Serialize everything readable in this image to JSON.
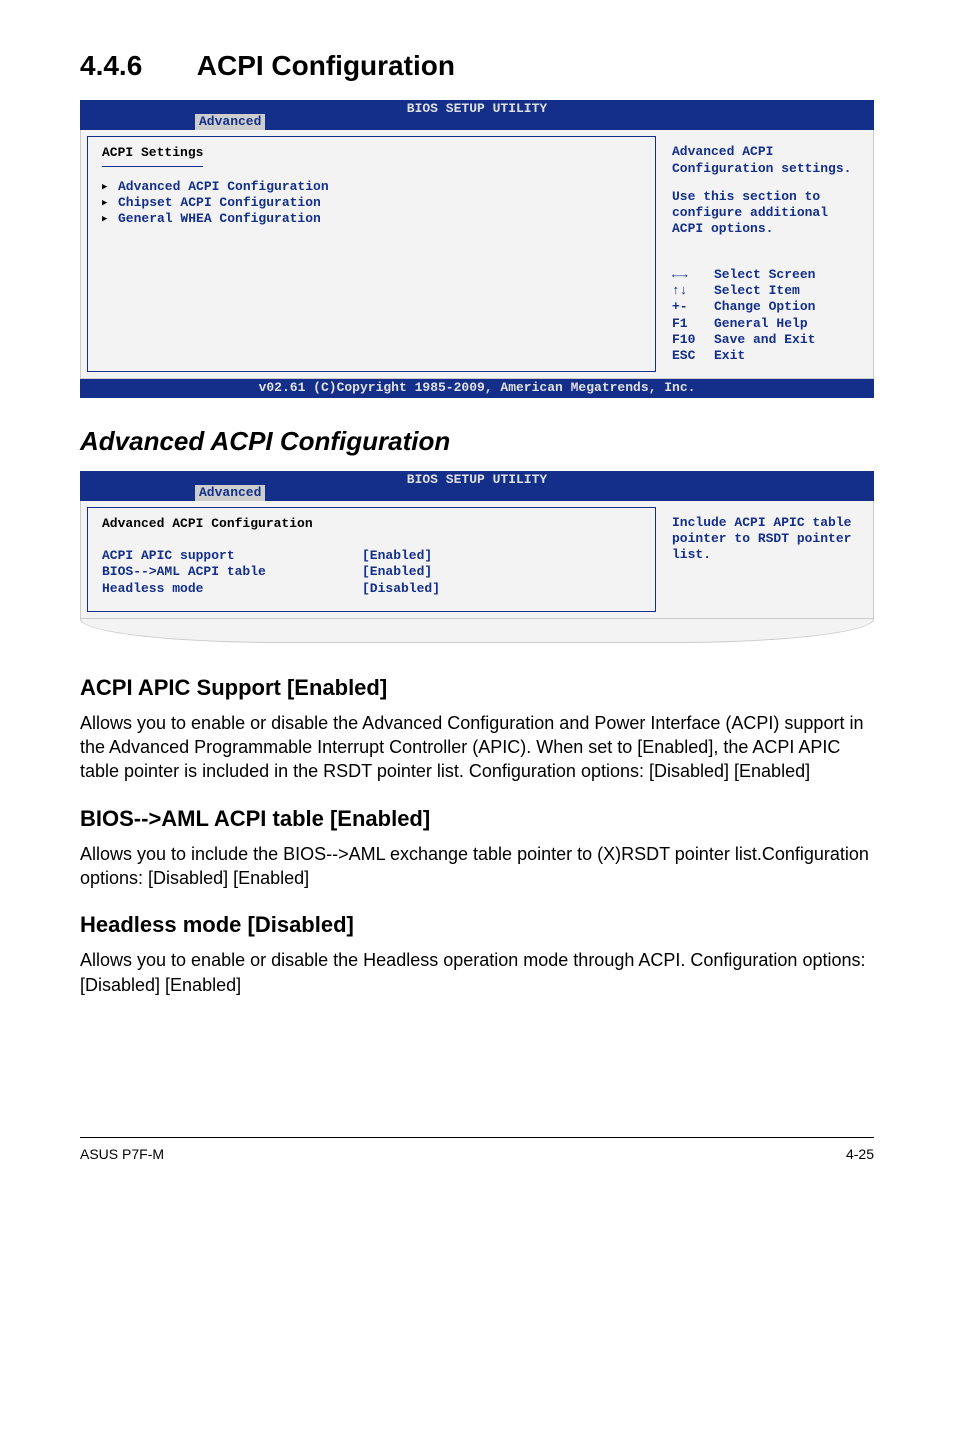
{
  "section": {
    "num": "4.4.6",
    "title": "ACPI Configuration"
  },
  "bios1": {
    "utility_title": "BIOS SETUP UTILITY",
    "tab": "Advanced",
    "heading": "ACPI Settings",
    "items": {
      "a": "Advanced ACPI Configuration",
      "b": "Chipset ACPI Configuration",
      "c": "General WHEA Configuration"
    },
    "help1": "Advanced ACPI Configuration settings.",
    "help2": "Use this section to configure additional ACPI options.",
    "nav": {
      "lr": {
        "key": "←→",
        "txt": "Select Screen"
      },
      "ud": {
        "key": "↑↓",
        "txt": "Select Item"
      },
      "pm": {
        "key": "+-",
        "txt": "Change Option"
      },
      "f1": {
        "key": "F1",
        "txt": "General Help"
      },
      "f10": {
        "key": "F10",
        "txt": "Save and Exit"
      },
      "esc": {
        "key": "ESC",
        "txt": "Exit"
      }
    },
    "footer": "v02.61 (C)Copyright 1985-2009, American Megatrends, Inc."
  },
  "subtitle1": "Advanced ACPI Configuration",
  "bios2": {
    "utility_title": "BIOS SETUP UTILITY",
    "tab": "Advanced",
    "heading": "Advanced ACPI Configuration",
    "rows": {
      "r1": {
        "k": "ACPI APIC support",
        "v": "[Enabled]"
      },
      "r2": {
        "k": "BIOS-->AML ACPI table",
        "v": "[Enabled]"
      },
      "r3": {
        "k": "Headless mode",
        "v": "[Disabled]"
      }
    },
    "help": "Include ACPI APIC table pointer to RSDT pointer list."
  },
  "feat1": {
    "title": "ACPI APIC Support [Enabled]",
    "body": "Allows you to enable or disable the Advanced Configuration and Power Interface (ACPI) support in the Advanced Programmable Interrupt Controller (APIC). When set to [Enabled], the ACPI APIC table pointer is included in the RSDT pointer list. Configuration options: [Disabled] [Enabled]"
  },
  "feat2": {
    "title": "BIOS-->AML ACPI table [Enabled]",
    "body": "Allows you to include the BIOS-->AML exchange table pointer to (X)RSDT pointer list.Configuration options: [Disabled] [Enabled]"
  },
  "feat3": {
    "title": "Headless mode [Disabled]",
    "body": "Allows you to enable or disable the Headless operation mode through ACPI. Configuration options: [Disabled] [Enabled]"
  },
  "footer": {
    "left": "ASUS P7F-M",
    "right": "4-25"
  }
}
